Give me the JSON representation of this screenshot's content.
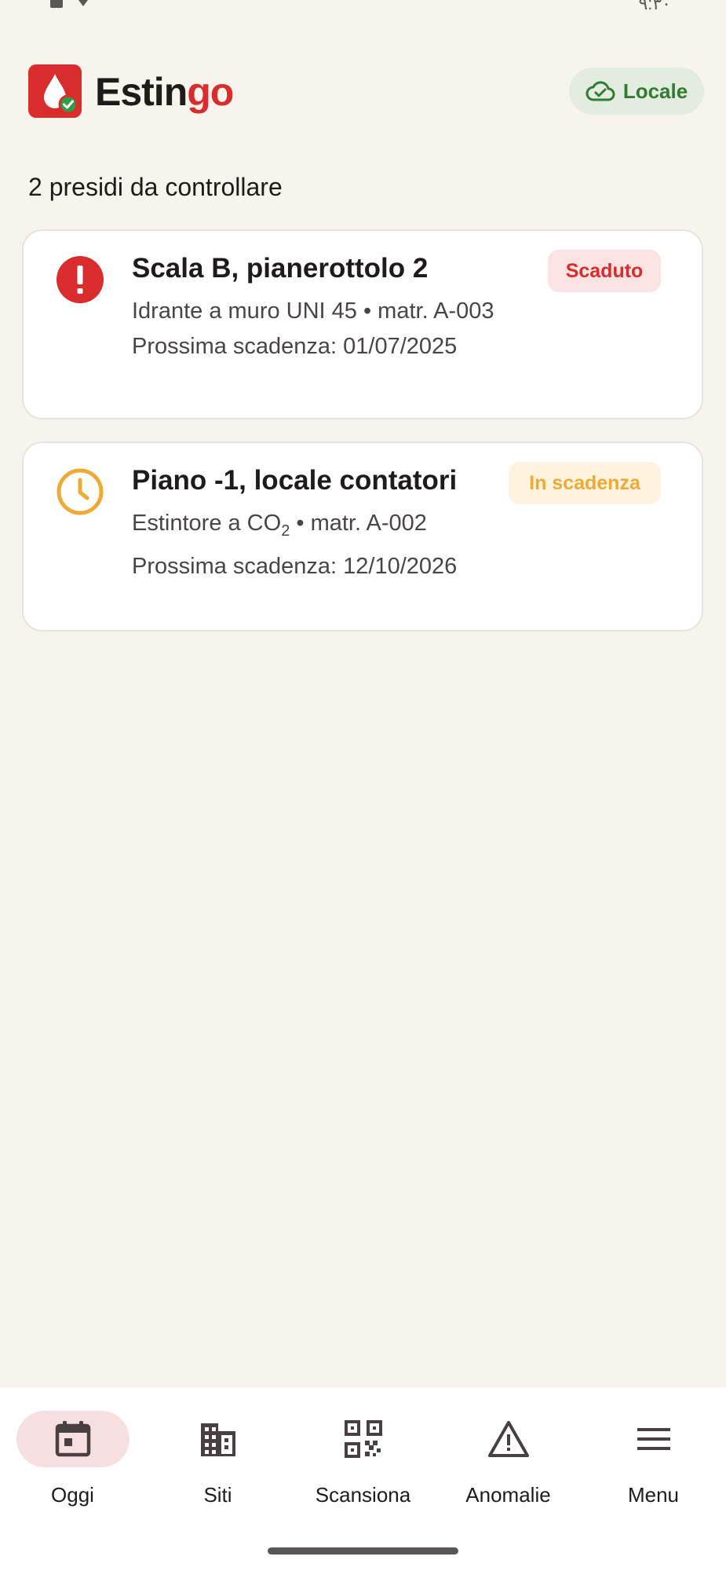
{
  "status_bar": {
    "time": "٩:٣٠"
  },
  "header": {
    "brand_part1": "Estin",
    "brand_part2": "go",
    "sync_chip_label": "Locale",
    "colors": {
      "brand": "#d92c2c",
      "sync": "#2e7d32"
    }
  },
  "main": {
    "section_title": "2 presidi da controllare",
    "cards": [
      {
        "status_icon": "error-icon",
        "title": "Scala B, pianerottolo 2",
        "subtitle_line1": "Idrante a muro UNI 45 • matr. A-003",
        "subtitle_line2": "Prossima scadenza: 01/07/2025",
        "badge": "Scaduto",
        "badge_color": "#d92c2c"
      },
      {
        "status_icon": "clock-icon",
        "title": "Piano -1, locale contatori",
        "subtitle_pre": "Estintore a CO",
        "subtitle_sub": "2",
        "subtitle_post": " • matr. A-002",
        "subtitle_line2": "Prossima scadenza: 12/10/2026",
        "badge": "In scadenza",
        "badge_color": "#efaa35"
      }
    ]
  },
  "bottom_nav": {
    "items": [
      {
        "label": "Oggi",
        "icon": "calendar-icon",
        "active": true
      },
      {
        "label": "Siti",
        "icon": "building-icon",
        "active": false
      },
      {
        "label": "Scansiona",
        "icon": "qr-code-icon",
        "active": false
      },
      {
        "label": "Anomalie",
        "icon": "warning-icon",
        "active": false
      },
      {
        "label": "Menu",
        "icon": "menu-icon",
        "active": false
      }
    ]
  }
}
